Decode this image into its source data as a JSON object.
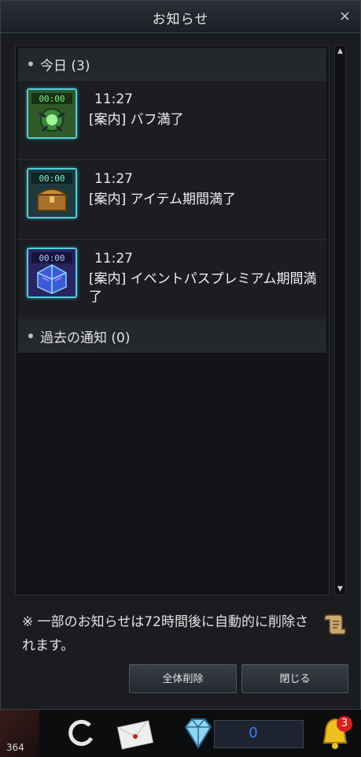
{
  "window": {
    "title": "お知らせ",
    "close_glyph": "×"
  },
  "today_section": {
    "label": "今日 (3)"
  },
  "notifications": [
    {
      "time": "11:27",
      "message": "[案内] バフ満了",
      "icon": "buff-icon"
    },
    {
      "time": "11:27",
      "message": "[案内] アイテム期間満了",
      "icon": "treasure-chest-icon"
    },
    {
      "time": "11:27",
      "message": "[案内] イベントパスプレミアム期間満了",
      "icon": "premium-pass-cube-icon"
    }
  ],
  "past_section": {
    "label": "過去の通知 (0)"
  },
  "note": "※ 一部のお知らせは72時間後に自動的に削除されます。",
  "buttons": {
    "delete_all": "全体削除",
    "close": "閉じる"
  },
  "hud": {
    "avatar_value": "364",
    "gem_count": "0",
    "bell_badge": "3"
  },
  "colors": {
    "icon_border": "#4fd1e0",
    "gem_count": "#3b7ff0",
    "badge": "#d91f1f"
  }
}
